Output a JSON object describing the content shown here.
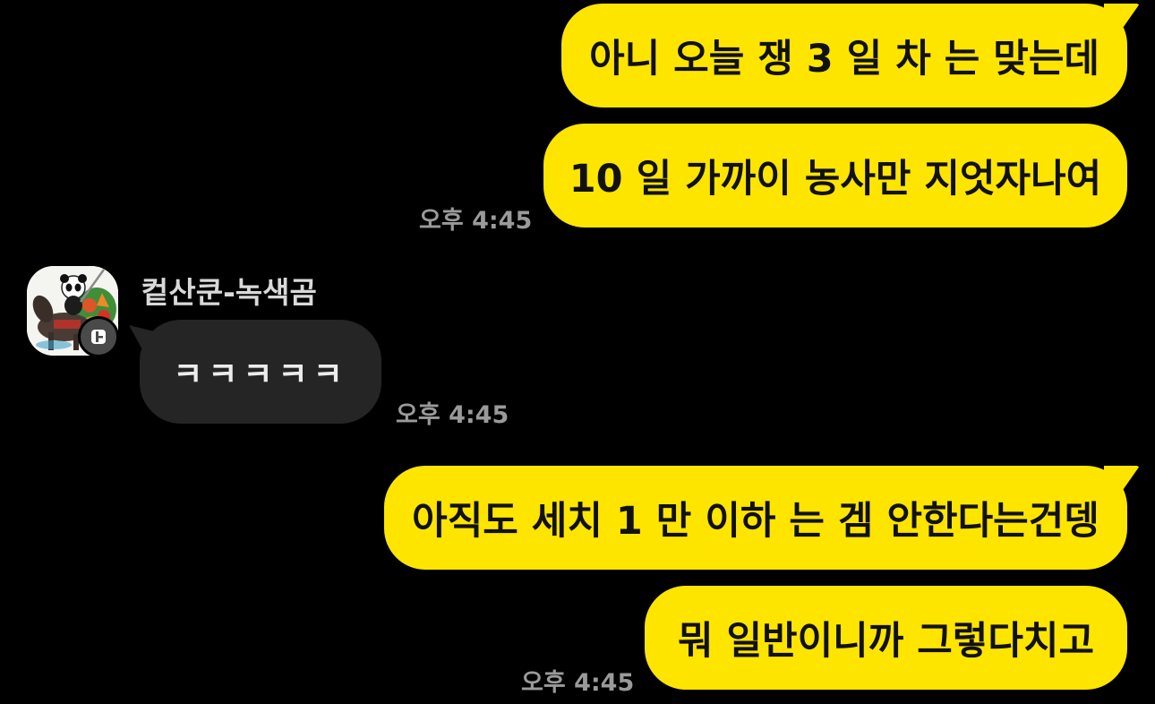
{
  "messages": [
    {
      "text": "아니 오늘 쟁 3 일 차 는 맞는데"
    },
    {
      "text": "10 일 가까이 농사만 지엇자나여"
    },
    {
      "text": "ㅋㅋㅋㅋㅋ"
    },
    {
      "text": "아직도 세치 1 만 이하 는 겜 안한다는건뎅"
    },
    {
      "text": "뭐 일반이니까 그렇다치고"
    }
  ],
  "timestamps": {
    "group1": "오후 4:45",
    "group2": "오후 4:45",
    "group3": "오후 4:45"
  },
  "sender": {
    "name": "컽산쿤-녹색곰",
    "avatar_icon": "panda-riding-horse-avatar",
    "badge_icon": "profile-badge-icon"
  },
  "colors": {
    "background": "#000000",
    "my_bubble": "#FEE500",
    "their_bubble": "#252525",
    "timestamp": "#9A9A9A"
  }
}
